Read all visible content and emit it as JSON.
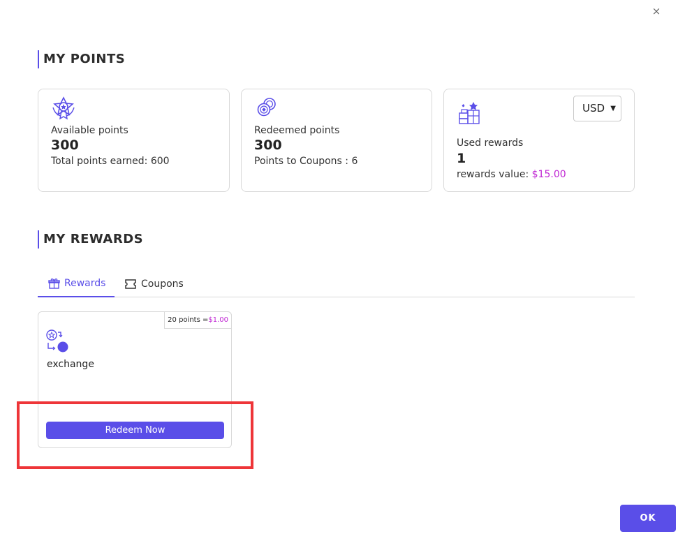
{
  "dialog": {
    "close_symbol": "×"
  },
  "points_section": {
    "title": "MY POINTS",
    "cards": [
      {
        "icon": "star-badge-icon",
        "label": "Available points",
        "value": "300",
        "sub_label": "Total points earned: 600"
      },
      {
        "icon": "coins-icon",
        "label": "Redeemed points",
        "value": "300",
        "sub_label": "Points to Coupons : 6"
      },
      {
        "icon": "gift-boxes-icon",
        "label": "Used rewards",
        "value": "1",
        "sub_label": "rewards value: ",
        "sub_value": "$15.00"
      }
    ],
    "currency": {
      "selected": "USD"
    }
  },
  "rewards_section": {
    "title": "MY REWARDS",
    "tabs": [
      {
        "label": "Rewards",
        "icon": "gift-icon",
        "active": true
      },
      {
        "label": "Coupons",
        "icon": "ticket-icon",
        "active": false
      }
    ],
    "items": [
      {
        "points_text": "20 points =",
        "price": "$1.00",
        "icon": "exchange-icon",
        "name": "exchange",
        "button_label": "Redeem Now"
      }
    ]
  },
  "footer": {
    "ok_label": "OK"
  },
  "colors": {
    "accent": "#5a4ee8",
    "value_purple": "#c026d3",
    "highlight_red": "#ee3538"
  }
}
